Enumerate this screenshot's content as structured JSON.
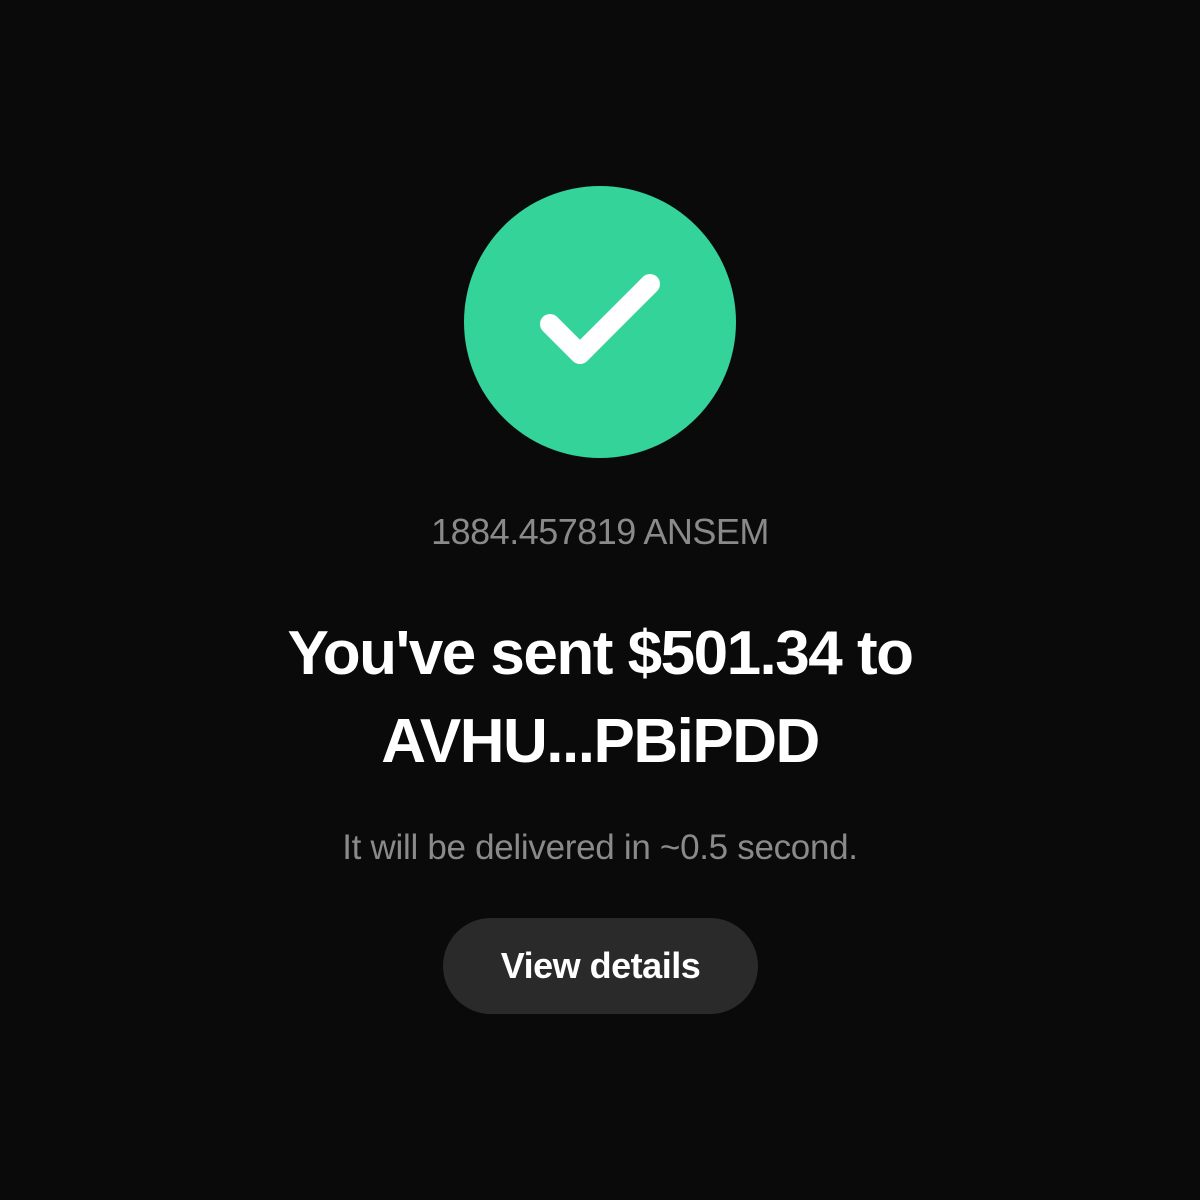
{
  "status": {
    "icon": "checkmark-icon",
    "color": "#34d399"
  },
  "transfer": {
    "token_amount": "1884.457819 ANSEM",
    "headline_line1": "You've sent $501.34 to",
    "headline_line2": "AVHU...PBiPDD",
    "delivery_note": "It will be delivered in ~0.5 second."
  },
  "actions": {
    "view_details_label": "View details"
  },
  "colors": {
    "background": "#0a0a0a",
    "accent": "#34d399",
    "muted_text": "#8a8a8a",
    "button_bg": "#2a2a2a"
  }
}
